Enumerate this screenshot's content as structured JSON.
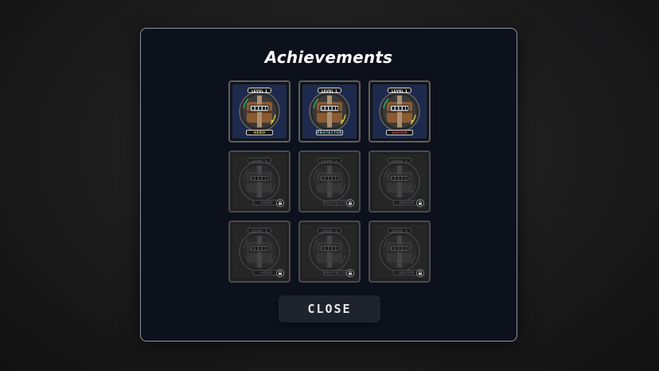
{
  "title": "Achievements",
  "close_label": "CLOSE",
  "colors": {
    "panel_bg": "#0d111c",
    "card_unlocked_bg": "#1d2a4d",
    "hero": "#e0c13a",
    "protector": "#7ec3e6",
    "savior": "#d2404a"
  },
  "achievements": [
    {
      "level": "LEVEL 1",
      "name": "HERO",
      "locked": false,
      "name_color": "#e0c13a",
      "icon": "treasure-chest-medal-icon"
    },
    {
      "level": "LEVEL 1",
      "name": "PROTECTOR",
      "locked": false,
      "name_color": "#7ec3e6",
      "icon": "treasure-chest-medal-icon"
    },
    {
      "level": "LEVEL 1",
      "name": "SAVIOR",
      "locked": false,
      "name_color": "#d2404a",
      "icon": "treasure-chest-medal-icon"
    },
    {
      "level": "LEVEL 2",
      "name": "HERO",
      "locked": true,
      "icon": "treasure-chest-medal-icon"
    },
    {
      "level": "LEVEL 2",
      "name": "PROTECTOR",
      "locked": true,
      "icon": "treasure-chest-medal-icon"
    },
    {
      "level": "LEVEL 2",
      "name": "SAVIOR",
      "locked": true,
      "icon": "treasure-chest-medal-icon"
    },
    {
      "level": "LEVEL 3",
      "name": "HERO",
      "locked": true,
      "icon": "treasure-chest-medal-icon"
    },
    {
      "level": "LEVEL 3",
      "name": "PROTECTOR",
      "locked": true,
      "icon": "treasure-chest-medal-icon"
    },
    {
      "level": "LEVEL 3",
      "name": "SAVIOR",
      "locked": true,
      "icon": "treasure-chest-medal-icon"
    }
  ]
}
